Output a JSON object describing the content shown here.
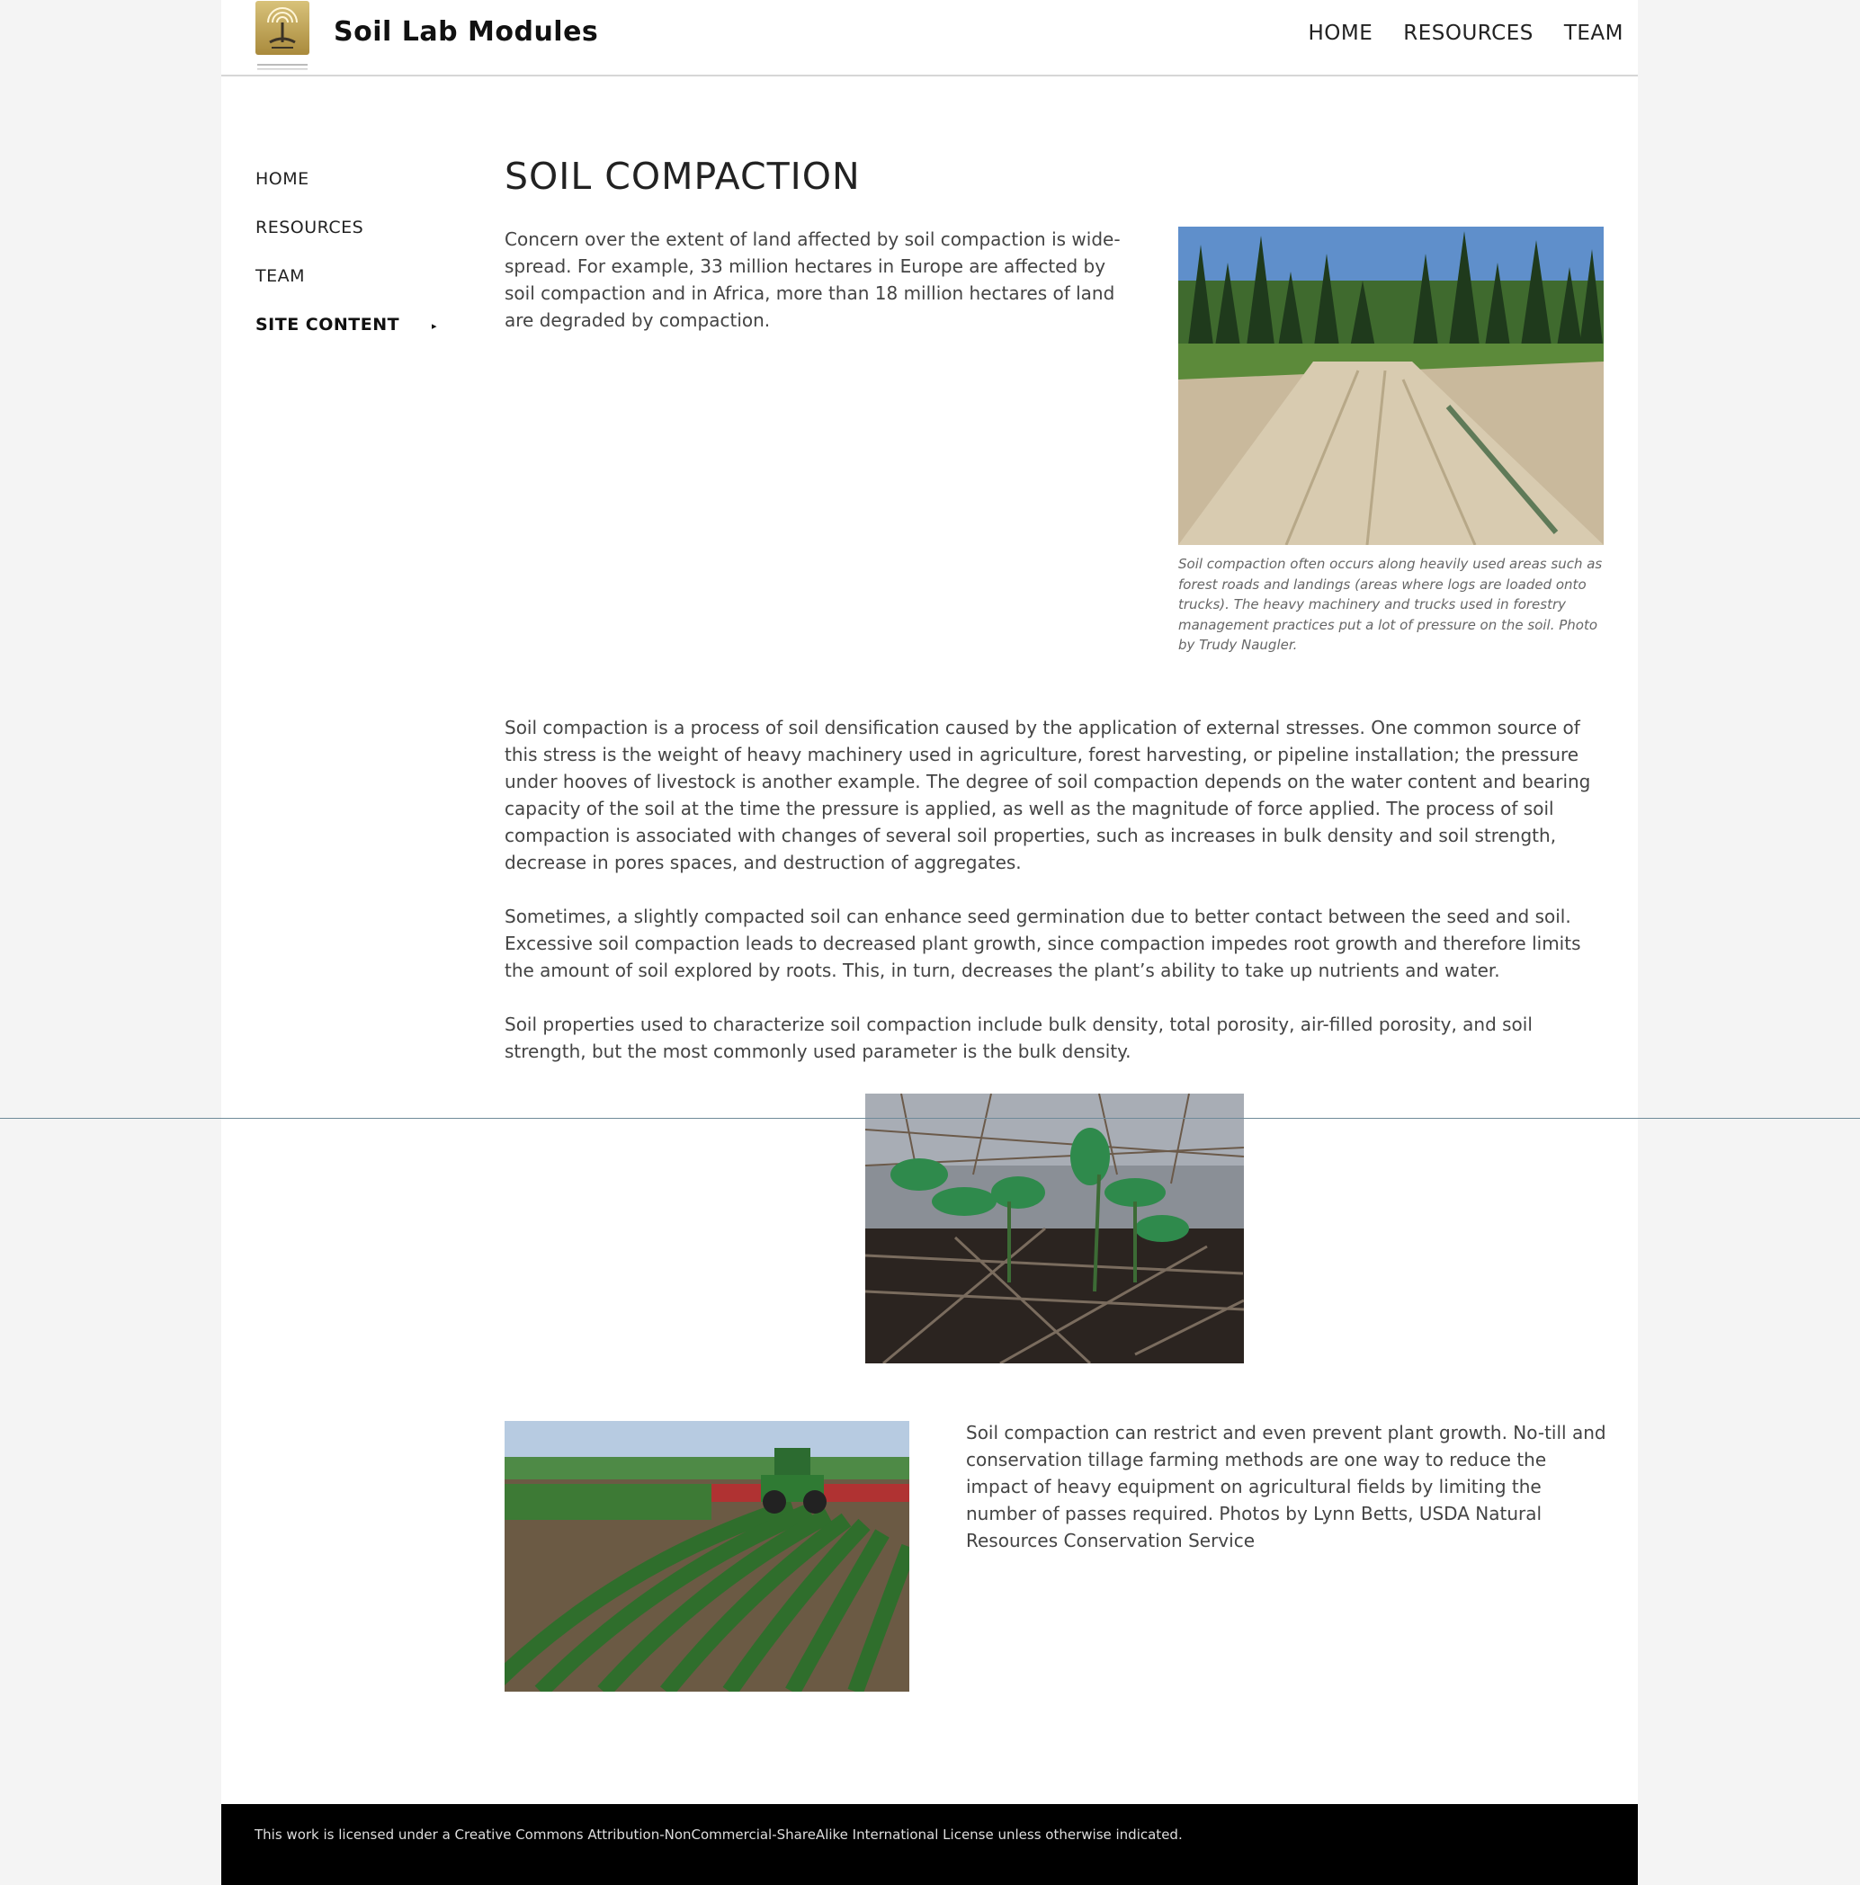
{
  "header": {
    "site_title": "Soil Lab Modules",
    "logo_icon": "tree-logo-icon",
    "nav": [
      "HOME",
      "RESOURCES",
      "TEAM"
    ]
  },
  "sidebar": {
    "items": [
      "HOME",
      "RESOURCES",
      "TEAM",
      "SITE CONTENT"
    ],
    "caret": "▸"
  },
  "main": {
    "title": "SOIL COMPACTION",
    "intro": "Concern over the extent of land affected by soil compaction is wide-spread. For example, 33 million hectares in Europe are affected by soil compaction and in Africa, more than 18 million hectares of land are degraded by compaction.",
    "forest_caption": "Soil compaction often occurs along heavily used areas such as forest roads and landings (areas where logs are loaded onto trucks). The heavy machinery and trucks used in forestry management practices put a lot of pressure on the soil. Photo by Trudy Naugler.",
    "para1": "Soil compaction is a process of soil densification caused by the application of external stresses. One common source of this stress is the weight of heavy machinery used in agriculture, forest harvesting, or pipeline installation; the pressure under hooves of livestock is another example. The degree of soil compaction depends on the water content and bearing capacity of the soil at the time the pressure is applied, as well as the magnitude of force applied. The process of soil compaction is associated with changes of several soil properties, such as increases in bulk density and soil strength, decrease in pores spaces, and destruction of aggregates.",
    "para2": "Sometimes, a slightly compacted soil can enhance seed germination due to better contact between the seed and soil. Excessive soil compaction leads to decreased plant growth, since compaction impedes root growth and therefore limits the amount of soil explored by roots. This, in turn, decreases the plant’s ability to take up nutrients and water.",
    "para3": "Soil properties used to characterize soil compaction include bulk density, total porosity, air-filled porosity, and soil strength, but the most commonly used parameter is the bulk density.",
    "tractor_caption": "Soil compaction can restrict and even prevent plant growth. No-till and conservation tillage farming methods are one way to reduce the impact of heavy equipment on agricultural fields by limiting the number of passes required. Photos by Lynn Betts, USDA Natural Resources Conservation Service"
  },
  "footer": {
    "license": "This work is licensed under a Creative Commons Attribution-NonCommercial-ShareAlike International License unless otherwise indicated."
  },
  "colors": {
    "footer_bg": "#000000",
    "logo_gold": "#c4a552",
    "divider": "#6f8a99"
  }
}
